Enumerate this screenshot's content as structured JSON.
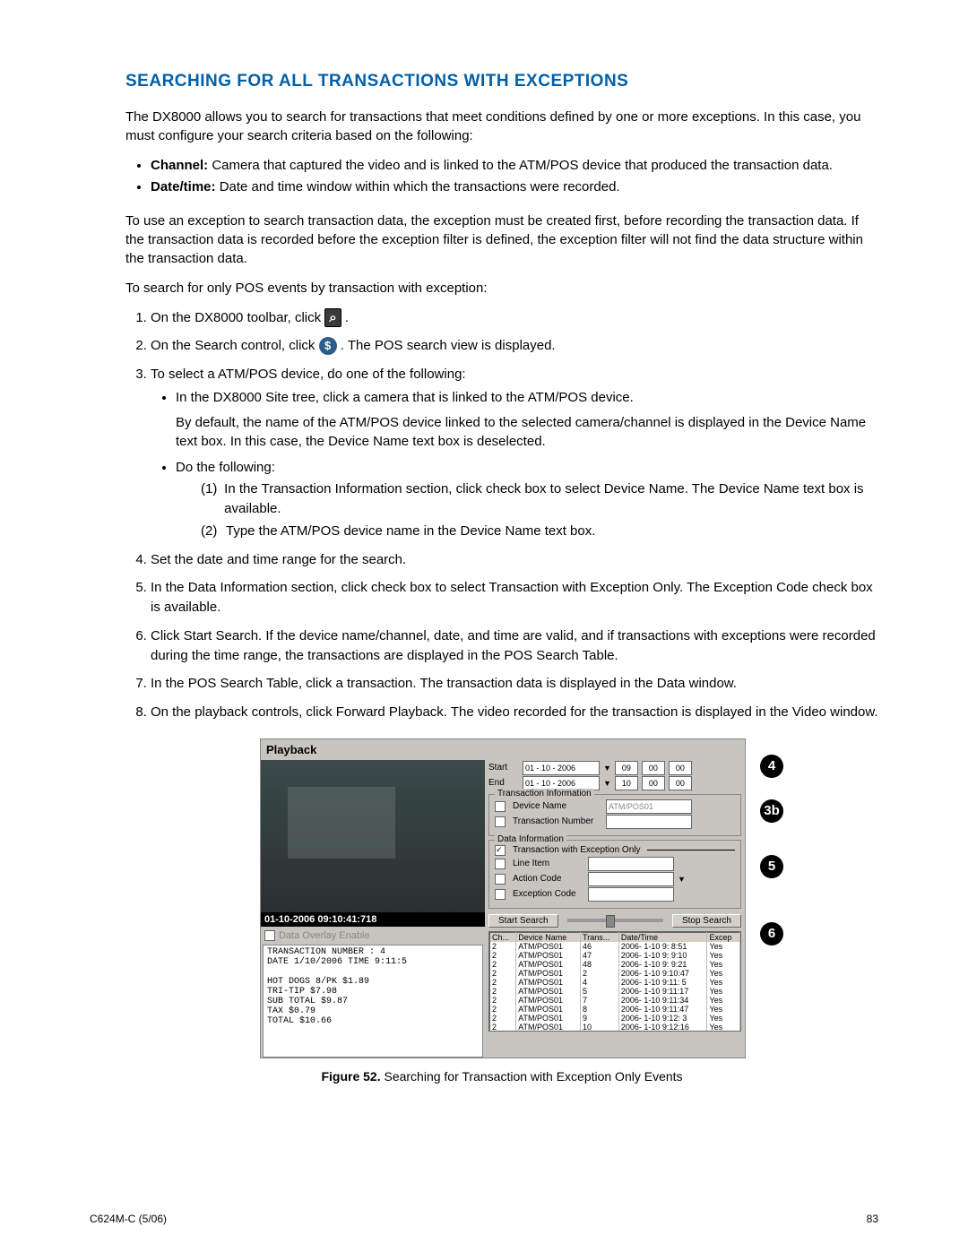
{
  "heading": "SEARCHING FOR ALL TRANSACTIONS WITH EXCEPTIONS",
  "intro": "The DX8000 allows you to search for transactions that meet conditions defined by one or more exceptions. In this case, you must configure your search criteria based on the following:",
  "criteria": {
    "channel_label": "Channel:",
    "channel_text": " Camera that captured the video and is linked to the ATM/POS device that produced the transaction data.",
    "datetime_label": "Date/time:",
    "datetime_text": " Date and time window within which the transactions were recorded."
  },
  "exception_note": "To use an exception to search transaction data, the exception must be created first, before recording the transaction data. If the transaction data is recorded before the exception filter is defined, the exception filter will not find the data structure within the transaction data.",
  "search_intro": "To search for only POS events by transaction with exception:",
  "steps": {
    "s1a": "On the DX8000 toolbar, click ",
    "s1b": " .",
    "s2a": "On the Search control, click ",
    "s2b": " . The POS search view is displayed.",
    "s3": "To select a ATM/POS device, do one of the following:",
    "s3_sub1": "In the DX8000 Site tree, click a camera that is linked to the ATM/POS device.",
    "s3_sub1_note": "By default, the name of the ATM/POS device linked to the selected camera/channel is displayed in the Device Name text box. In this case, the Device Name text box is deselected.",
    "s3_sub2": "Do the following:",
    "s3_sub2_1": "In the Transaction Information section, click check box to select Device Name. The Device Name text box is available.",
    "s3_sub2_2": "Type the ATM/POS device name in the Device Name text box.",
    "s4": "Set the date and time range for the search.",
    "s5": "In the Data Information section, click check box to select Transaction with Exception Only. The Exception Code check box is available.",
    "s6": "Click Start Search. If the device name/channel, date, and time are valid, and if transactions with exceptions were recorded during the time range, the transactions are displayed in the POS Search Table.",
    "s7": "In the POS Search Table, click a transaction. The transaction data is displayed in the Data window.",
    "s8": "On the playback controls, click Forward Playback. The video recorded for the transaction is displayed in the Video window."
  },
  "figure": {
    "label": "Figure 52.",
    "caption": "  Searching for Transaction with Exception Only Events",
    "panel_title": "Playback",
    "timestamp": "01-10-2006 09:10:41:718",
    "overlay_label": "Data Overlay Enable",
    "receipt": [
      "TRANSACTION NUMBER : 4",
      "DATE 1/10/2006   TIME 9:11:5",
      "",
      "HOT DOGS 8/PK     $1.89",
      "TRI-TIP           $7.98",
      "SUB TOTAL         $9.87",
      "TAX               $0.79",
      "TOTAL            $10.66"
    ],
    "start_label": "Start",
    "end_label": "End",
    "start_date": "01 - 10 - 2006",
    "end_date": "01 - 10 - 2006",
    "start_h": "09",
    "start_m": "00",
    "start_s": "00",
    "end_h": "10",
    "end_m": "00",
    "end_s": "00",
    "group_trans": "Transaction Information",
    "device_name_label": "Device Name",
    "device_name_value": "ATM/POS01",
    "trans_num_label": "Transaction Number",
    "group_data": "Data Information",
    "exc_only_label": "Transaction with Exception Only",
    "line_item_label": "Line Item",
    "action_code_label": "Action Code",
    "exception_code_label": "Exception Code",
    "start_search": "Start Search",
    "stop_search": "Stop Search",
    "table_headers": [
      "Ch...",
      "Device Name",
      "Trans...",
      "Date/Time",
      "Excep"
    ],
    "table_rows": [
      [
        "2",
        "ATM/POS01",
        "46",
        "2006- 1-10  9: 8:51",
        "Yes"
      ],
      [
        "2",
        "ATM/POS01",
        "47",
        "2006- 1-10  9: 9:10",
        "Yes"
      ],
      [
        "2",
        "ATM/POS01",
        "48",
        "2006- 1-10  9: 9:21",
        "Yes"
      ],
      [
        "2",
        "ATM/POS01",
        "2",
        "2006- 1-10  9:10:47",
        "Yes"
      ],
      [
        "2",
        "ATM/POS01",
        "4",
        "2006- 1-10  9:11: 5",
        "Yes"
      ],
      [
        "2",
        "ATM/POS01",
        "5",
        "2006- 1-10  9:11:17",
        "Yes"
      ],
      [
        "2",
        "ATM/POS01",
        "7",
        "2006- 1-10  9:11:34",
        "Yes"
      ],
      [
        "2",
        "ATM/POS01",
        "8",
        "2006- 1-10  9:11:47",
        "Yes"
      ],
      [
        "2",
        "ATM/POS01",
        "9",
        "2006- 1-10  9:12: 3",
        "Yes"
      ],
      [
        "2",
        "ATM/POS01",
        "10",
        "2006- 1-10  9:12:16",
        "Yes"
      ]
    ],
    "callouts": {
      "c4": "4",
      "c3b": "3b",
      "c5": "5",
      "c6": "6"
    }
  },
  "footer": {
    "left": "C624M-C (5/06)",
    "right": "83"
  }
}
